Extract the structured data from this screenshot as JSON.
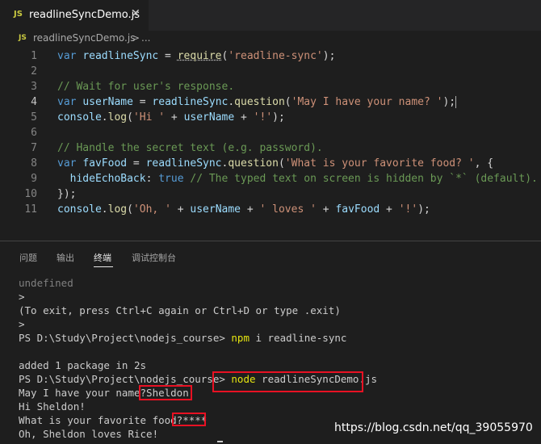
{
  "tab": {
    "icon_label": "JS",
    "file_name": "readlineSyncDemo.js",
    "close_glyph": "✕"
  },
  "breadcrumb": {
    "icon_label": "JS",
    "file_name": "readlineSyncDemo.js",
    "separator": ">",
    "more": "..."
  },
  "editor": {
    "current_line": 4,
    "lines": [
      {
        "n": "1",
        "tokens": [
          [
            "kw",
            "var "
          ],
          [
            "var",
            "readlineSync"
          ],
          [
            "pl",
            " = "
          ],
          [
            "fn squig",
            "require"
          ],
          [
            "pl",
            "("
          ],
          [
            "str",
            "'readline-sync'"
          ],
          [
            "pl",
            ");"
          ]
        ]
      },
      {
        "n": "2",
        "tokens": []
      },
      {
        "n": "3",
        "tokens": [
          [
            "cm",
            "// Wait for user's response."
          ]
        ]
      },
      {
        "n": "4",
        "tokens": [
          [
            "kw",
            "var "
          ],
          [
            "var",
            "userName"
          ],
          [
            "pl",
            " = "
          ],
          [
            "var",
            "readlineSync"
          ],
          [
            "pl",
            "."
          ],
          [
            "fn",
            "question"
          ],
          [
            "pl",
            "("
          ],
          [
            "str",
            "'May I have your name? '"
          ],
          [
            "pl",
            ");"
          ]
        ]
      },
      {
        "n": "5",
        "tokens": [
          [
            "var",
            "console"
          ],
          [
            "pl",
            "."
          ],
          [
            "fn",
            "log"
          ],
          [
            "pl",
            "("
          ],
          [
            "str",
            "'Hi '"
          ],
          [
            "pl",
            " + "
          ],
          [
            "var",
            "userName"
          ],
          [
            "pl",
            " + "
          ],
          [
            "str",
            "'!'"
          ],
          [
            "pl",
            ");"
          ]
        ]
      },
      {
        "n": "6",
        "tokens": []
      },
      {
        "n": "7",
        "tokens": [
          [
            "cm",
            "// Handle the secret text (e.g. password)."
          ]
        ]
      },
      {
        "n": "8",
        "tokens": [
          [
            "kw",
            "var "
          ],
          [
            "var",
            "favFood"
          ],
          [
            "pl",
            " = "
          ],
          [
            "var",
            "readlineSync"
          ],
          [
            "pl",
            "."
          ],
          [
            "fn",
            "question"
          ],
          [
            "pl",
            "("
          ],
          [
            "str",
            "'What is your favorite food? '"
          ],
          [
            "pl",
            ", {"
          ]
        ]
      },
      {
        "n": "9",
        "tokens": [
          [
            "pl",
            "  "
          ],
          [
            "var",
            "hideEchoBack"
          ],
          [
            "pl",
            ": "
          ],
          [
            "kw",
            "true"
          ],
          [
            "pl",
            " "
          ],
          [
            "cm",
            "// The typed text on screen is hidden by `*` (default)."
          ]
        ]
      },
      {
        "n": "10",
        "tokens": [
          [
            "pl",
            "});"
          ]
        ]
      },
      {
        "n": "11",
        "tokens": [
          [
            "var",
            "console"
          ],
          [
            "pl",
            "."
          ],
          [
            "fn",
            "log"
          ],
          [
            "pl",
            "("
          ],
          [
            "str",
            "'Oh, '"
          ],
          [
            "pl",
            " + "
          ],
          [
            "var",
            "userName"
          ],
          [
            "pl",
            " + "
          ],
          [
            "str",
            "' loves '"
          ],
          [
            "pl",
            " + "
          ],
          [
            "var",
            "favFood"
          ],
          [
            "pl",
            " + "
          ],
          [
            "str",
            "'!'"
          ],
          [
            "pl",
            ");"
          ]
        ]
      }
    ]
  },
  "panel": {
    "tabs": [
      {
        "label": "问题",
        "active": false
      },
      {
        "label": "输出",
        "active": false
      },
      {
        "label": "终端",
        "active": true
      },
      {
        "label": "调试控制台",
        "active": false
      }
    ]
  },
  "terminal": {
    "undefined": "undefined",
    "prompt1": ">",
    "exit_hint": "(To exit, press Ctrl+C again or Ctrl+D or type .exit)",
    "prompt2": ">",
    "ps_prompt": "PS D:\\Study\\Project\\nodejs_course>",
    "cmd1_name": "npm",
    "cmd1_args": " i readline-sync",
    "added": "added 1 package in 2s",
    "cmd2_name": "node",
    "cmd2_args": " readlineSyncDemo.js",
    "q1": "May I have your name?",
    "a1": "Sheldon",
    "hi": "Hi Sheldon!",
    "q2": "What is your favorite food?",
    "a2": "****",
    "result": "Oh, Sheldon loves Rice!"
  },
  "watermark": "https://blog.csdn.net/qq_39055970",
  "colors": {
    "highlight_box": "#e81123",
    "keyword": "#569cd6",
    "string": "#ce9178",
    "comment": "#6a9955",
    "function": "#dcdcaa",
    "variable": "#9cdcfe"
  }
}
